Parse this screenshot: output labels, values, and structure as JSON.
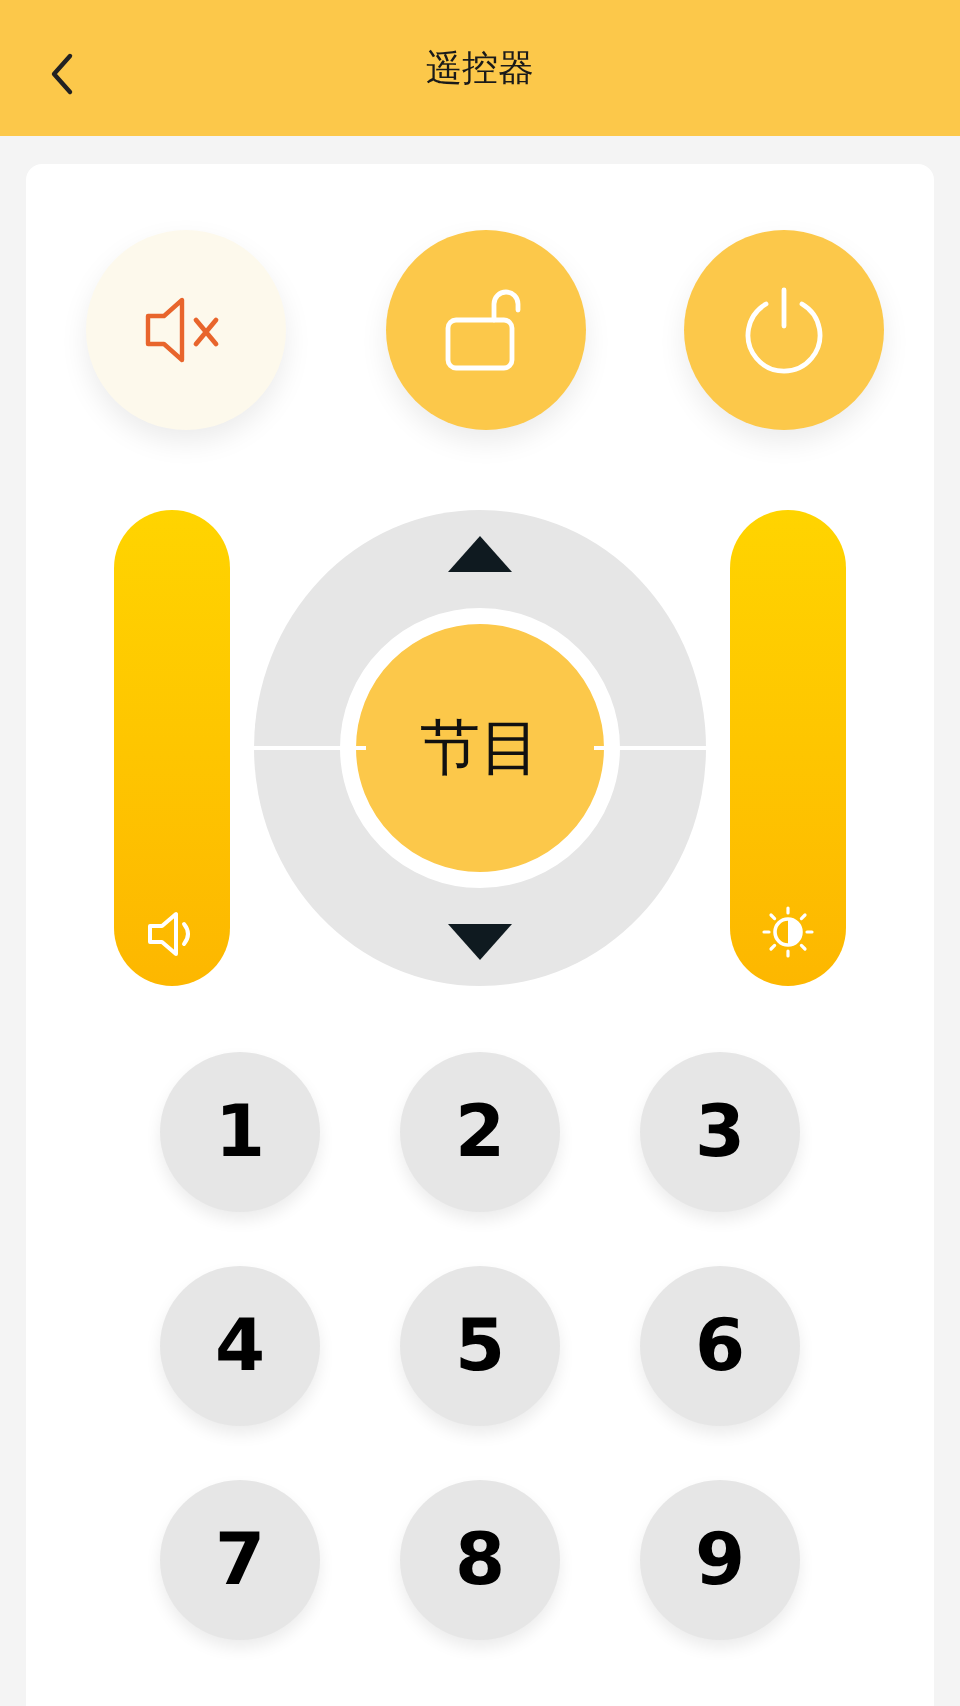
{
  "header": {
    "title": "遥控器"
  },
  "top_buttons": [
    {
      "kind": "mute",
      "active": true
    },
    {
      "kind": "lock",
      "active": false
    },
    {
      "kind": "power",
      "active": false
    }
  ],
  "sliders": [
    {
      "kind": "volume"
    },
    {
      "kind": "brightness"
    }
  ],
  "dpad": {
    "center": "节目"
  },
  "keys": [
    "1",
    "2",
    "3",
    "4",
    "5",
    "6",
    "7",
    "8",
    "9"
  ]
}
